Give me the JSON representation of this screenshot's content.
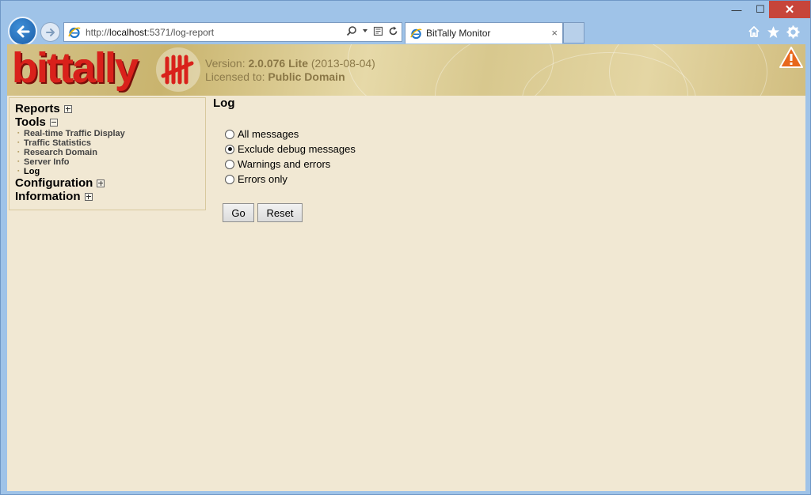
{
  "window": {
    "min": "—",
    "max": "☐",
    "close": "✕"
  },
  "browser": {
    "url_prefix": "http://",
    "url_host": "localhost",
    "url_rest": ":5371/log-report",
    "tab_title": "BitTally Monitor",
    "tab_close": "×"
  },
  "header": {
    "logo_text": "bittally",
    "version_label": "Version:",
    "version_value": "2.0.076 Lite",
    "version_date": "(2013-08-04)",
    "licensed_label": "Licensed to:",
    "licensed_value": "Public Domain"
  },
  "sidebar": {
    "reports": "Reports",
    "tools": "Tools",
    "tools_items": [
      "Real-time Traffic Display",
      "Traffic Statistics",
      "Research Domain",
      "Server Info",
      "Log"
    ],
    "configuration": "Configuration",
    "information": "Information"
  },
  "main": {
    "title": "Log",
    "options": [
      "All messages",
      "Exclude debug messages",
      "Warnings and errors",
      "Errors only"
    ],
    "selected_index": 1,
    "go_label": "Go",
    "reset_label": "Reset"
  },
  "colors": {
    "page_bg": "#f1e8d3",
    "logo_red": "#d9211b",
    "chrome_blue": "#9fc3e8"
  },
  "icons": [
    "back-arrow-icon",
    "forward-arrow-icon",
    "ie-logo-icon",
    "search-icon",
    "refresh-icon",
    "home-icon",
    "star-icon",
    "gear-icon",
    "warning-icon",
    "tally-marks-icon"
  ]
}
